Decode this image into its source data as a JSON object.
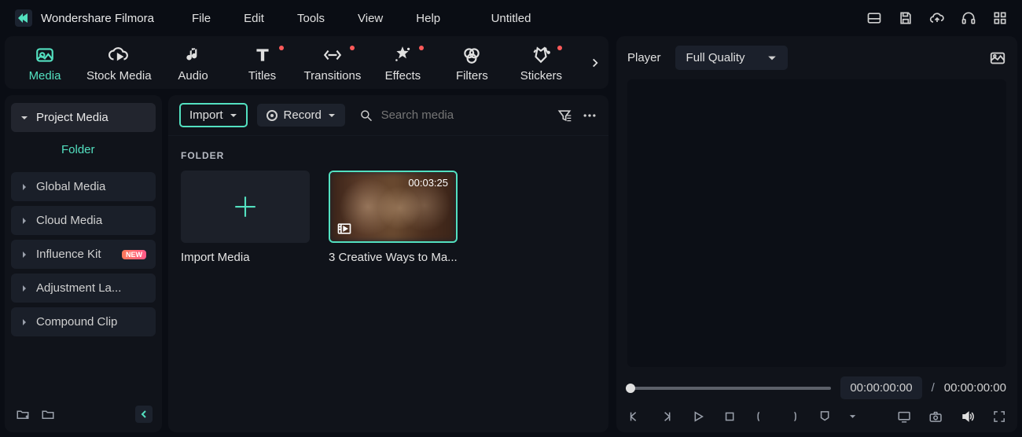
{
  "app": {
    "name": "Wondershare Filmora"
  },
  "menu": {
    "file": "File",
    "edit": "Edit",
    "tools": "Tools",
    "view": "View",
    "help": "Help"
  },
  "document": {
    "title": "Untitled"
  },
  "tabs": {
    "media": "Media",
    "stock": "Stock Media",
    "audio": "Audio",
    "titles": "Titles",
    "transitions": "Transitions",
    "effects": "Effects",
    "filters": "Filters",
    "stickers": "Stickers"
  },
  "sidebar": {
    "project_media": "Project Media",
    "folder": "Folder",
    "global_media": "Global Media",
    "cloud_media": "Cloud Media",
    "influence_kit": "Influence Kit",
    "influence_kit_badge": "NEW",
    "adjustment_layer": "Adjustment La...",
    "compound_clip": "Compound Clip"
  },
  "browser": {
    "import_label": "Import",
    "record_label": "Record",
    "search_placeholder": "Search media",
    "section_label": "FOLDER",
    "items": [
      {
        "caption": "Import Media"
      },
      {
        "caption": "3 Creative Ways to Ma...",
        "duration": "00:03:25"
      }
    ]
  },
  "player": {
    "label": "Player",
    "quality": "Full Quality",
    "current_time": "00:00:00:00",
    "total_time": "00:00:00:00",
    "separator": "/"
  },
  "icons": {
    "layouts": "layouts-icon",
    "save": "save-icon",
    "cloud": "cloud-icon",
    "support": "support-icon",
    "apps": "apps-icon"
  }
}
